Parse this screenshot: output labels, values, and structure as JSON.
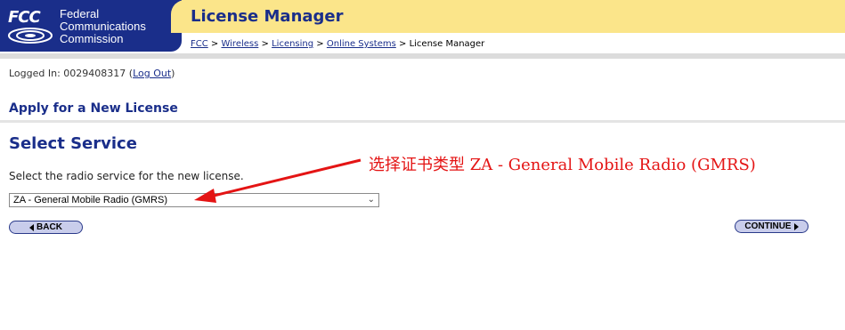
{
  "header": {
    "logo_mark": "FCC",
    "agency_lines": [
      "Federal",
      "Communications",
      "Commission"
    ],
    "app_title": "License Manager",
    "breadcrumb": {
      "links": [
        "FCC",
        "Wireless",
        "Licensing",
        "Online Systems"
      ],
      "current": "License Manager",
      "separator": ">"
    },
    "colors": {
      "brand_blue": "#1a2e8a",
      "title_bar": "#fbe58a"
    }
  },
  "session": {
    "prefix": "Logged In: 0029408317 (",
    "logout_label": "Log Out",
    "suffix": ")"
  },
  "section_title": "Apply for a New License",
  "page_heading": "Select Service",
  "instruction": "Select the radio service for the new license.",
  "service_select": {
    "selected_value": "ZA - General Mobile Radio (GMRS)",
    "icon": "chevron-down-icon"
  },
  "buttons": {
    "back_label": "BACK",
    "continue_label": "CONTINUE"
  },
  "annotation": {
    "text": "选择证书类型 ZA - General Mobile Radio (GMRS)",
    "color": "#e41414"
  }
}
